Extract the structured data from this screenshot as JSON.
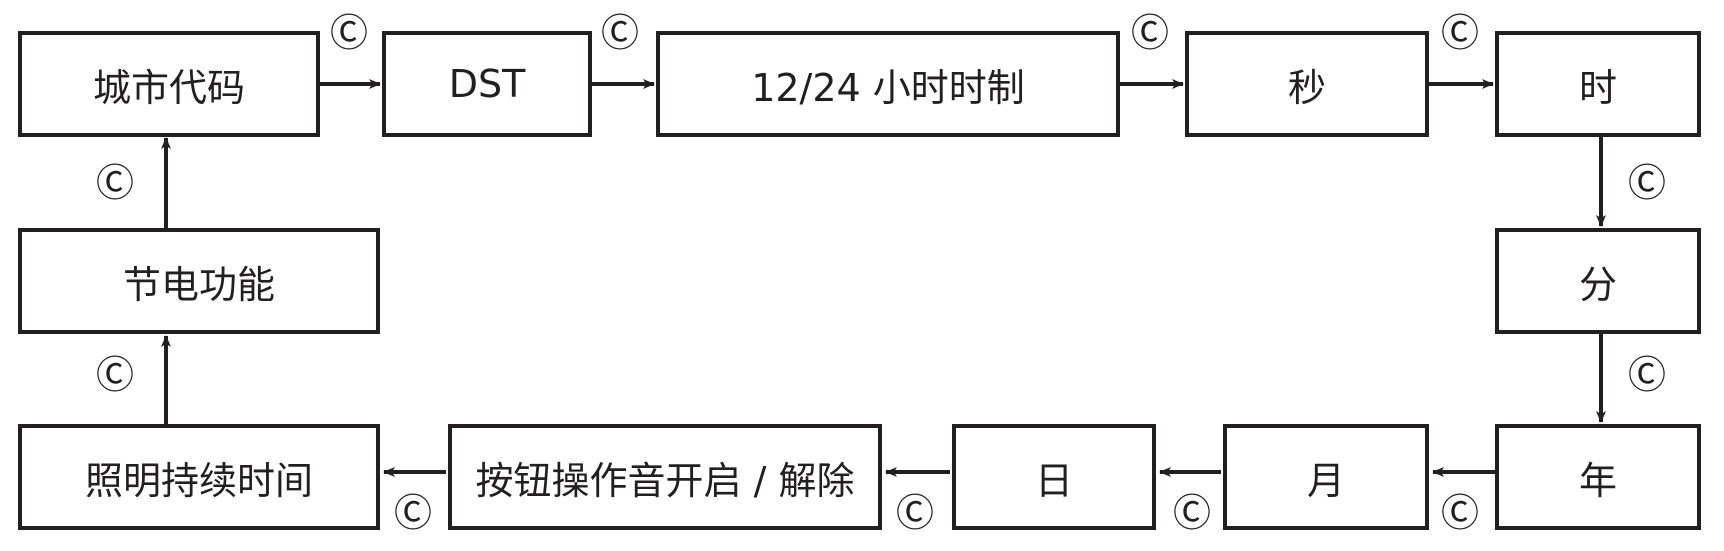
{
  "nodes": {
    "city_code": "城市代码",
    "dst": "DST",
    "hour_format": "12/24 小时时制",
    "second": "秒",
    "hour": "时",
    "minute": "分",
    "year": "年",
    "month": "月",
    "day": "日",
    "button_tone": "按钮操作音开启 / 解除",
    "light_duration": "照明持续时间",
    "power_saving": "节电功能"
  },
  "button_label": "Ⓒ",
  "colors": {
    "line": "#231f20",
    "background": "#ffffff"
  }
}
